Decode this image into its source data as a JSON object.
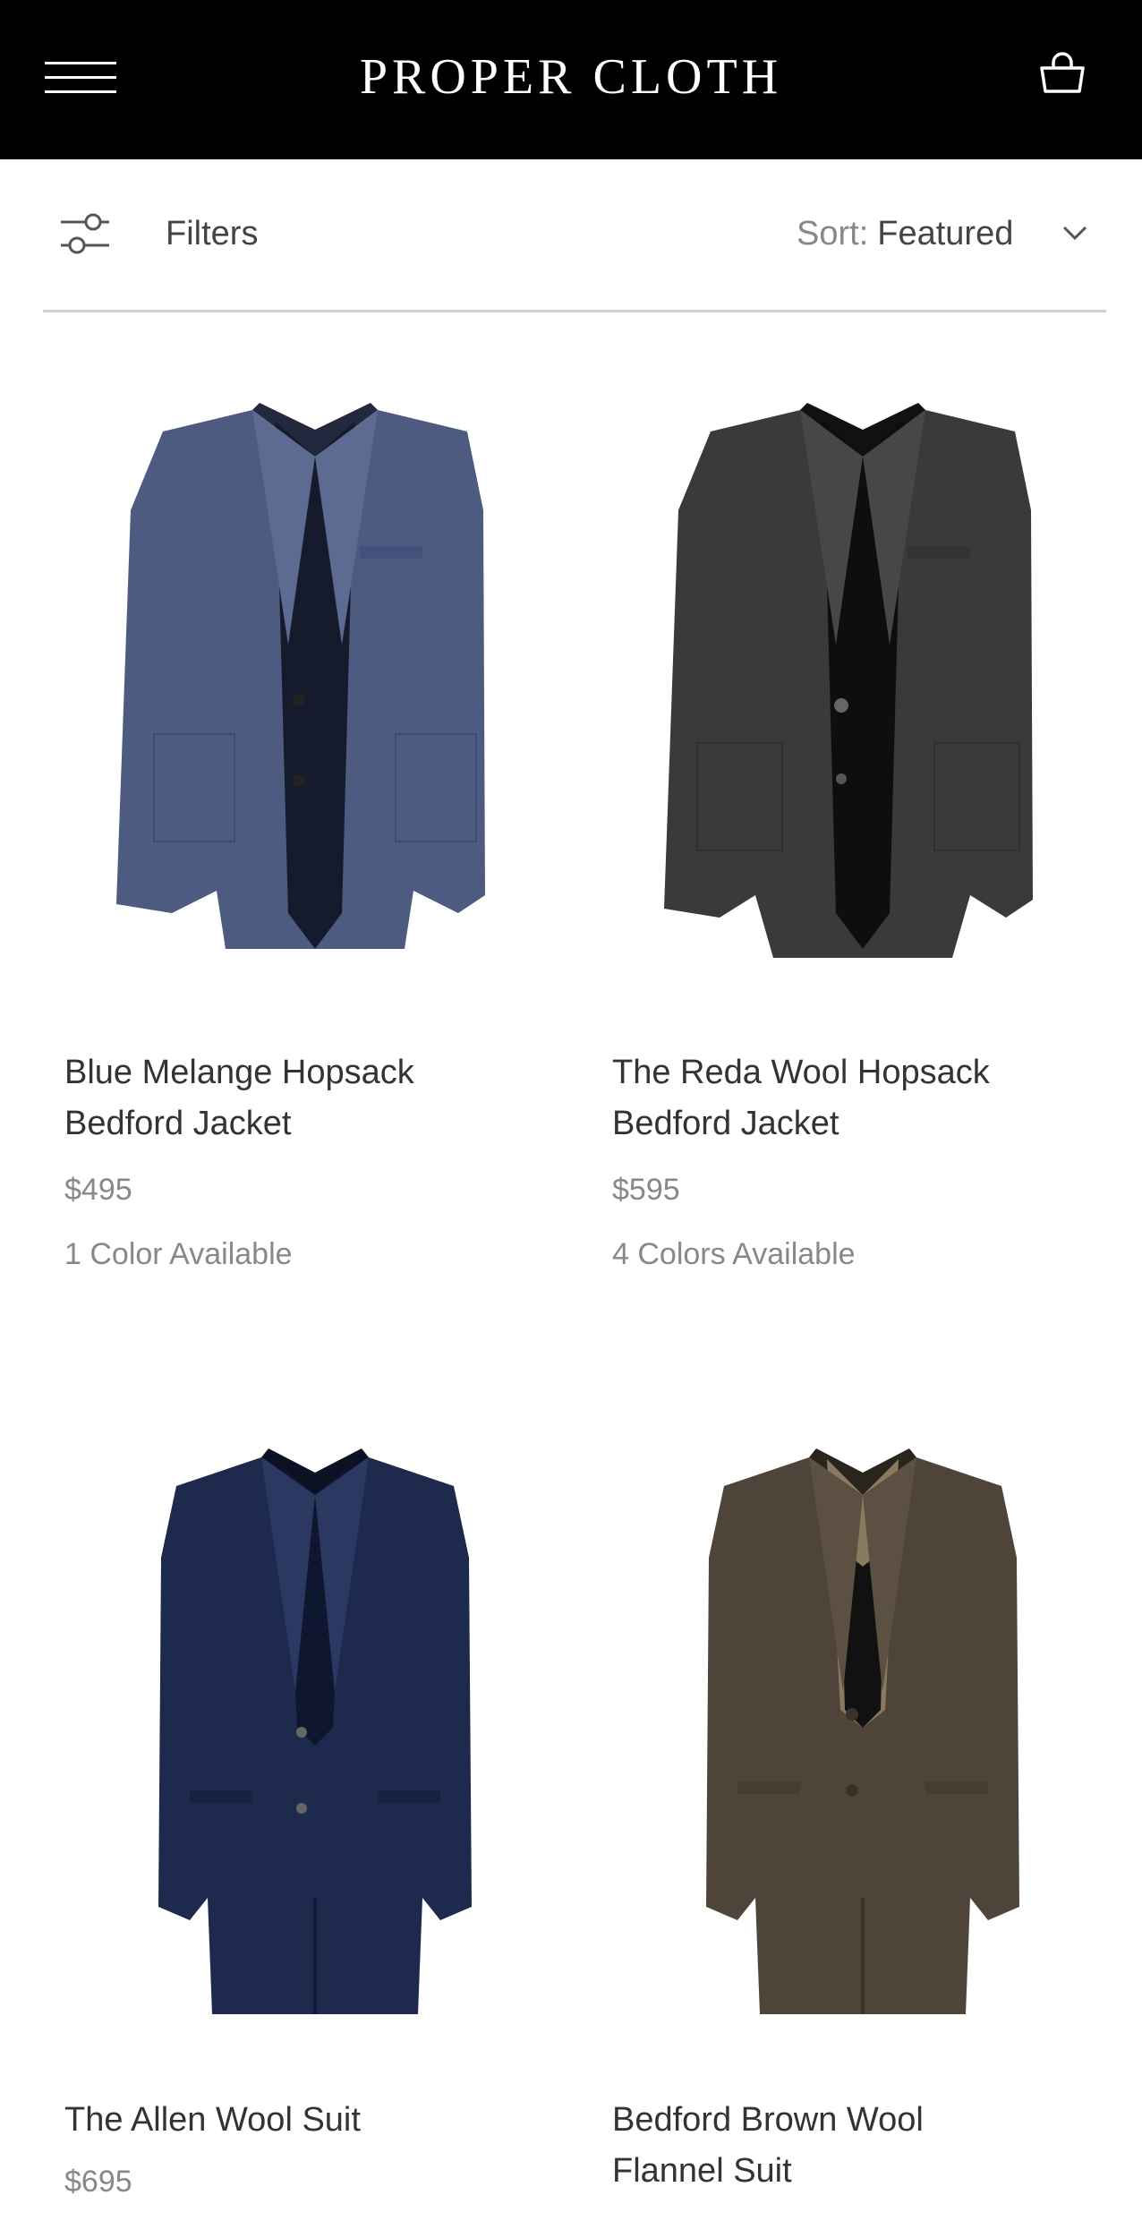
{
  "header": {
    "brand": "PROPER CLOTH",
    "menu_icon": "hamburger-menu-icon",
    "cart_icon": "shopping-bag-icon",
    "background": "#000000"
  },
  "toolbar": {
    "filters_label": "Filters",
    "filters_icon": "sliders-icon",
    "sort_prefix": "Sort:",
    "sort_value": "Featured",
    "sort_icon": "chevron-down-icon"
  },
  "products": [
    {
      "name_line1": "Blue Melange Hopsack",
      "name_line2": "Bedford Jacket",
      "price": "$495",
      "colors": "1 Color Available",
      "image_color": "#4d5b80"
    },
    {
      "name_line1": "The Reda Wool Hopsack",
      "name_line2": "Bedford Jacket",
      "price": "$595",
      "colors": "4 Colors Available",
      "image_color": "#3a3a3a"
    },
    {
      "name_line1": "The Allen Wool Suit",
      "name_line2": "",
      "price": "$695",
      "colors": "",
      "image_color": "#1e2a4d"
    },
    {
      "name_line1": "Bedford Brown Wool",
      "name_line2": "Flannel Suit",
      "price": "",
      "colors": "",
      "image_color": "#4e4439"
    }
  ]
}
